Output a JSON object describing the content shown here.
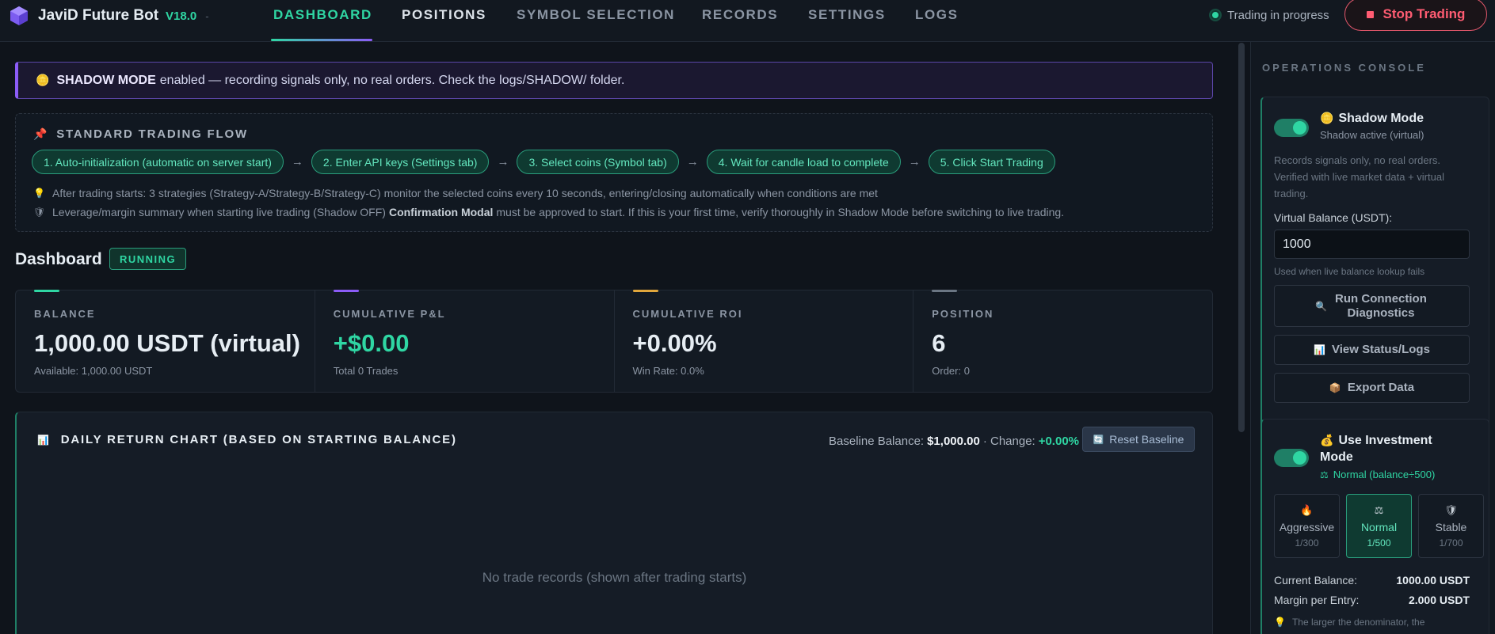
{
  "header": {
    "app_name": "JaviD Future Bot",
    "version": "V18.0",
    "separator": "-",
    "tabs": [
      {
        "label": "DASHBOARD",
        "active": true
      },
      {
        "label": "POSITIONS",
        "active": false
      },
      {
        "label": "SYMBOL SELECTION",
        "active": false
      },
      {
        "label": "RECORDS",
        "active": false
      },
      {
        "label": "SETTINGS",
        "active": false
      },
      {
        "label": "LOGS",
        "active": false
      }
    ],
    "status_text": "Trading in progress",
    "stop_label": "Stop Trading"
  },
  "banner": {
    "icon": "gem-icon",
    "bold": "SHADOW MODE",
    "text": "enabled — recording signals only, no real orders. Check the logs/SHADOW/ folder."
  },
  "flow": {
    "title": "STANDARD TRADING FLOW",
    "steps": [
      "1. Auto-initialization (automatic on server start)",
      "2. Enter API keys (Settings tab)",
      "3. Select coins (Symbol tab)",
      "4. Wait for candle load to complete",
      "5. Click Start Trading"
    ],
    "arrow": "→",
    "note1": "After trading starts: 3 strategies (Strategy-A/Strategy-B/Strategy-C) monitor the selected coins every 10 seconds, entering/closing automatically when conditions are met",
    "note2_pre": "Leverage/margin summary when starting live trading (Shadow OFF)",
    "note2_bold": "Confirmation Modal",
    "note2_post": "must be approved to start. If this is your first time, verify thoroughly in Shadow Mode before switching to live trading."
  },
  "dashboard": {
    "title": "Dashboard",
    "badge": "RUNNING",
    "stats": [
      {
        "label": "BALANCE",
        "value": "1,000.00 USDT (virtual)",
        "sub": "Available: 1,000.00 USDT",
        "accent": "#2fd6a3"
      },
      {
        "label": "CUMULATIVE P&L",
        "value": "+$0.00",
        "sub": "Total 0 Trades",
        "accent": "#8b5cf6"
      },
      {
        "label": "CUMULATIVE ROI",
        "value": "+0.00%",
        "sub": "Win Rate: 0.0%",
        "accent": "#e0a63c"
      },
      {
        "label": "POSITION",
        "value": "6",
        "sub": "Order: 0",
        "accent": "#6b7683"
      }
    ]
  },
  "chart": {
    "title": "DAILY RETURN CHART (BASED ON STARTING BALANCE)",
    "baseline_label": "Baseline Balance:",
    "baseline_value": "$1,000.00",
    "change_label": "· Change:",
    "change_value": "+0.00%",
    "reset_label": "Reset Baseline",
    "empty_text": "No trade records (shown after trading starts)"
  },
  "console": {
    "title": "OPERATIONS CONSOLE",
    "shadow": {
      "title": "Shadow Mode",
      "status": "Shadow active (virtual)",
      "enabled": true,
      "desc": "Records signals only, no real orders. Verified with live market data + virtual trading.",
      "balance_label": "Virtual Balance (USDT):",
      "balance_value": "1000",
      "balance_hint": "Used when live balance lookup fails",
      "btn_diag": "Run Connection Diagnostics",
      "btn_status": "View Status/Logs",
      "btn_export": "Export Data"
    },
    "invest": {
      "title": "Use Investment Mode",
      "status": "Normal (balance÷500)",
      "enabled": true,
      "modes": [
        {
          "name": "Aggressive",
          "ratio": "1/300",
          "icon": "fire-icon",
          "selected": false
        },
        {
          "name": "Normal",
          "ratio": "1/500",
          "icon": "scale-icon",
          "selected": true
        },
        {
          "name": "Stable",
          "ratio": "1/700",
          "icon": "shield-icon",
          "selected": false
        }
      ],
      "current_balance_label": "Current Balance:",
      "current_balance_value": "1000.00 USDT",
      "margin_label": "Margin per Entry:",
      "margin_value": "2.000 USDT",
      "tip": "The larger the denominator, the"
    }
  }
}
